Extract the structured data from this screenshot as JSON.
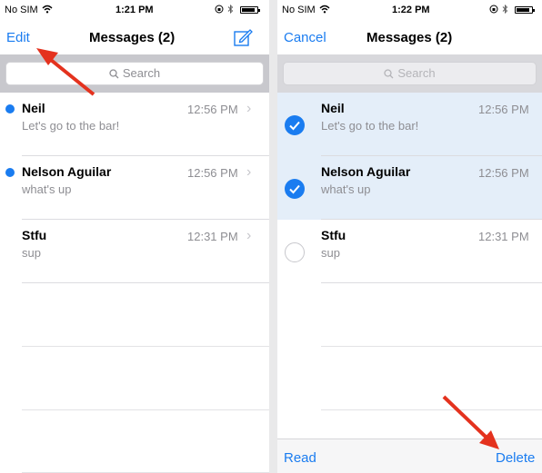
{
  "colors": {
    "accent": "#1a7cf0",
    "arrow": "#e4321e",
    "selected_row": "#e4eef9"
  },
  "left": {
    "status": {
      "carrier": "No SIM",
      "time": "1:21 PM"
    },
    "nav": {
      "edit_label": "Edit",
      "title": "Messages (2)",
      "compose_icon": "compose-icon"
    },
    "search": {
      "placeholder": "Search"
    },
    "conversations": [
      {
        "name": "Neil",
        "preview": "Let's go to the bar!",
        "time": "12:56 PM",
        "unread": true
      },
      {
        "name": "Nelson Aguilar",
        "preview": "what's up",
        "time": "12:56 PM",
        "unread": true
      },
      {
        "name": "Stfu",
        "preview": "sup",
        "time": "12:31 PM",
        "unread": false
      }
    ]
  },
  "right": {
    "status": {
      "carrier": "No SIM",
      "time": "1:22 PM"
    },
    "nav": {
      "cancel_label": "Cancel",
      "title": "Messages (2)"
    },
    "search": {
      "placeholder": "Search"
    },
    "conversations": [
      {
        "name": "Neil",
        "preview": "Let's go to the bar!",
        "time": "12:56 PM",
        "selected": true
      },
      {
        "name": "Nelson Aguilar",
        "preview": "what's up",
        "time": "12:56 PM",
        "selected": true
      },
      {
        "name": "Stfu",
        "preview": "sup",
        "time": "12:31 PM",
        "selected": false
      }
    ],
    "toolbar": {
      "read_label": "Read",
      "delete_label": "Delete"
    }
  }
}
